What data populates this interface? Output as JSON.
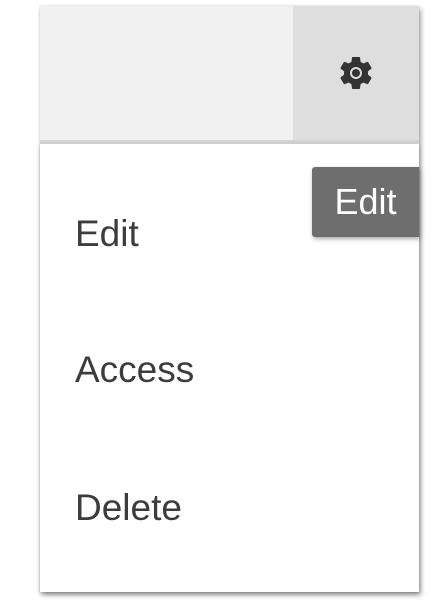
{
  "header": {
    "settings_icon": "gear-icon"
  },
  "menu": {
    "items": [
      {
        "label": "Edit"
      },
      {
        "label": "Access"
      },
      {
        "label": "Delete"
      }
    ]
  },
  "tooltip": {
    "text": "Edit"
  },
  "colors": {
    "header_bg": "#f1f1f1",
    "gear_button_bg": "#dedede",
    "tooltip_bg": "#6e6e6e",
    "menu_text": "#3c3c3c"
  }
}
